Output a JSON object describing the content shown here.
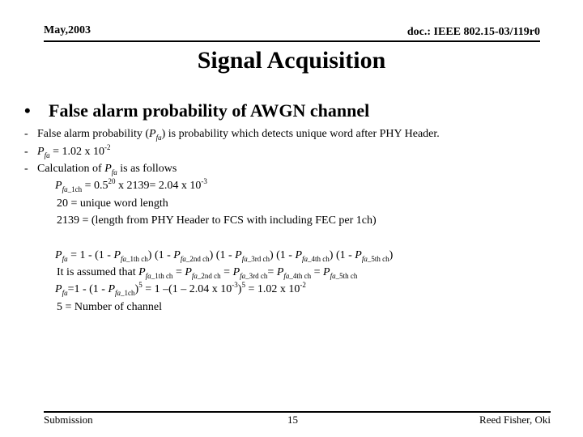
{
  "header": {
    "date": "May,2003",
    "doc_id": "doc.: IEEE 802.15-03/119r0"
  },
  "title": "Signal Acquisition",
  "bullet": {
    "symbol": "•",
    "text": "False alarm probability of AWGN channel"
  },
  "items": {
    "dash": "-",
    "definition": {
      "pre": "False alarm probability (",
      "P": "P",
      "sub": "fa",
      "post": ") is probability which detects unique word after PHY Header."
    },
    "value": {
      "P": "P",
      "sub": "fa",
      "eq": " = 1.02 x 10",
      "exp": "-2"
    },
    "calc_intro": {
      "pre": "Calculation of ",
      "P": "P",
      "sub": "fa",
      "post": " is as follows"
    }
  },
  "calc": {
    "single": {
      "P": "P",
      "sub_italic": "fa",
      "sub_plain": "_1ch",
      "eq1": " = 0.5",
      "exp1": "20",
      "eq2": " x 2139= 2.04 x 10",
      "exp2": "-3"
    },
    "uw_length": "20 = unique word length",
    "frame_length": "2139 = (length from PHY Header to FCS with including FEC per 1ch)",
    "total": {
      "P": "P",
      "sub": "fa",
      "eq": " = 1 - (1 - ",
      "terms": [
        {
          "P": "P",
          "sub_italic": "fa",
          "sub_plain": "_1th ch",
          "tail": ") (1 - "
        },
        {
          "P": "P",
          "sub_italic": "fa",
          "sub_plain": "_2nd ch",
          "tail": ") (1 - "
        },
        {
          "P": "P",
          "sub_italic": "fa",
          "sub_plain": "_3rd ch",
          "tail": ") (1 - "
        },
        {
          "P": "P",
          "sub_italic": "fa",
          "sub_plain": "_4th ch",
          "tail": ") (1 - "
        },
        {
          "P": "P",
          "sub_italic": "fa",
          "sub_plain": "_5th ch",
          "tail": ")"
        }
      ]
    },
    "assumption": {
      "pre": "It is assumed that ",
      "terms": [
        {
          "P": "P",
          "sub_italic": "fa",
          "sub_plain": "_1th ch",
          "tail": " = "
        },
        {
          "P": "P",
          "sub_italic": "fa",
          "sub_plain": "_2nd ch",
          "tail": " = "
        },
        {
          "P": "P",
          "sub_italic": "fa",
          "sub_plain": "_3rd ch",
          "tail": "= "
        },
        {
          "P": "P",
          "sub_italic": "fa",
          "sub_plain": "_4th ch",
          "tail": " = "
        },
        {
          "P": "P",
          "sub_italic": "fa",
          "sub_plain": "_5th ch",
          "tail": ""
        }
      ]
    },
    "result": {
      "P": "P",
      "sub": "fa",
      "eq1": "=1 - (1 - ",
      "P2": "P",
      "sub2_italic": "fa",
      "sub2_plain": "_1ch",
      "eq2": ")",
      "exp1": "5",
      "eq3": " = 1 –(1 – 2.04 x 10",
      "exp2": "-3",
      "eq4": ")",
      "exp3": "5",
      "eq5": " = 1.02 x 10",
      "exp4": "-2"
    },
    "channels": "5 = Number of channel"
  },
  "footer": {
    "left": "Submission",
    "page": "15",
    "author": "Reed Fisher, Oki"
  }
}
